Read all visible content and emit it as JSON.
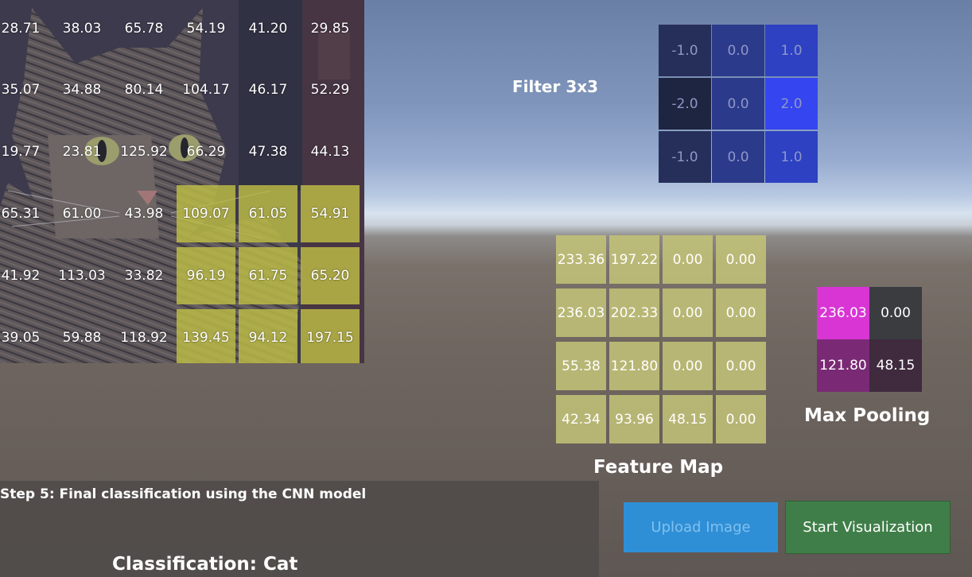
{
  "input_image": {
    "cells": [
      [
        "28.71",
        "38.03",
        "65.78",
        "54.19",
        "41.20",
        "29.85"
      ],
      [
        "35.07",
        "34.88",
        "80.14",
        "104.17",
        "46.17",
        "52.29"
      ],
      [
        "19.77",
        "23.81",
        "125.92",
        "66.29",
        "47.38",
        "44.13"
      ],
      [
        "65.31",
        "61.00",
        "43.98",
        "109.07",
        "61.05",
        "54.91"
      ],
      [
        "41.92",
        "113.03",
        "33.82",
        "96.19",
        "61.75",
        "65.20"
      ],
      [
        "39.05",
        "59.88",
        "118.92",
        "139.45",
        "94.12",
        "197.15"
      ]
    ],
    "highlight_rows": [
      3,
      4,
      5
    ],
    "highlight_cols": [
      3,
      4,
      5
    ]
  },
  "filter": {
    "label": "Filter 3x3",
    "cells": [
      [
        "-1.0",
        "0.0",
        "1.0"
      ],
      [
        "-2.0",
        "0.0",
        "2.0"
      ],
      [
        "-1.0",
        "0.0",
        "1.0"
      ]
    ],
    "colors": [
      [
        "#262f5a",
        "#2b3a8a",
        "#2d41c2"
      ],
      [
        "#1e2540",
        "#2b3a8a",
        "#3545ef"
      ],
      [
        "#262f5a",
        "#2b3a8a",
        "#2d41c2"
      ]
    ]
  },
  "feature_map": {
    "label": "Feature Map",
    "cells": [
      [
        "233.36",
        "197.22",
        "0.00",
        "0.00"
      ],
      [
        "236.03",
        "202.33",
        "0.00",
        "0.00"
      ],
      [
        "55.38",
        "121.80",
        "0.00",
        "0.00"
      ],
      [
        "42.34",
        "93.96",
        "48.15",
        "0.00"
      ]
    ]
  },
  "max_pooling": {
    "label": "Max Pooling",
    "cells": [
      [
        "236.03",
        "0.00"
      ],
      [
        "121.80",
        "48.15"
      ]
    ],
    "colors": [
      [
        "#d835d4",
        "#3a3c40"
      ],
      [
        "#7a2a75",
        "#3f2a3e"
      ]
    ]
  },
  "step": {
    "text": "Step 5: Final classification using the CNN model"
  },
  "classification": {
    "text": "Classification: Cat"
  },
  "buttons": {
    "upload": "Upload Image",
    "start": "Start Visualization"
  }
}
